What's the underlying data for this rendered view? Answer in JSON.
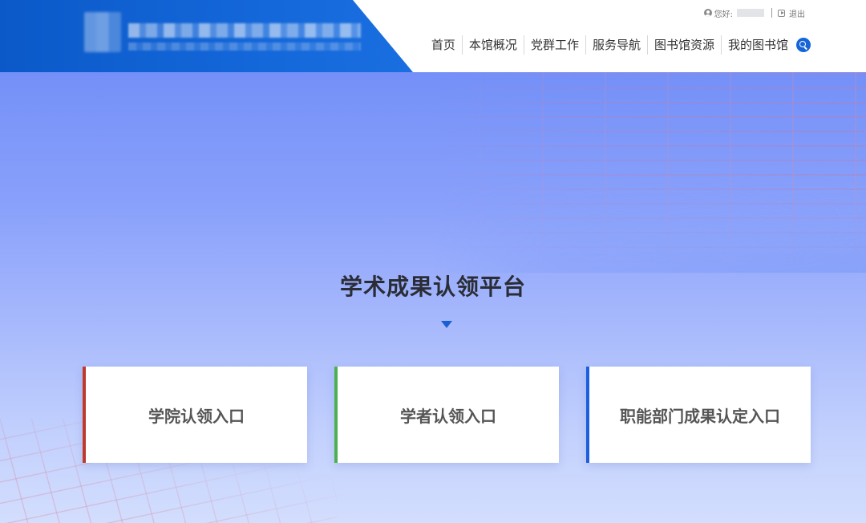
{
  "header": {
    "user_greeting": "您好:",
    "logout_label": "退出",
    "nav": [
      {
        "label": "首页"
      },
      {
        "label": "本馆概况"
      },
      {
        "label": "党群工作"
      },
      {
        "label": "服务导航"
      },
      {
        "label": "图书馆资源"
      },
      {
        "label": "我的图书馆"
      }
    ],
    "search_icon": "search-icon"
  },
  "main": {
    "title": "学术成果认领平台",
    "entries": [
      {
        "label": "学院认领入口",
        "accent": "#c0392b"
      },
      {
        "label": "学者认领入口",
        "accent": "#4cb050"
      },
      {
        "label": "职能部门成果认定入口",
        "accent": "#1a5fdd"
      }
    ]
  },
  "colors": {
    "brand_blue": "#1467d9",
    "title_text": "#2b2d36",
    "arrow": "#1a5fcf"
  }
}
